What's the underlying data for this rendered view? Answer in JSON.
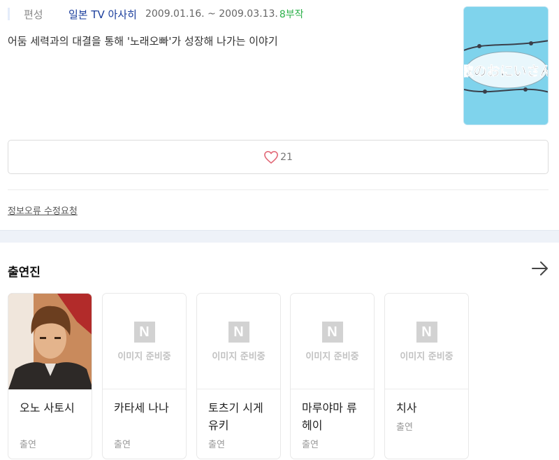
{
  "info": {
    "label": "편성",
    "broadcaster": "일본 TV 아사히",
    "dates": "2009.01.16. ~ 2009.03.13.",
    "episodes": "8부작",
    "synopsis": "어둠 세력과의 대결을 통해 '노래오빠'가 성장해 나가는 이야기",
    "poster_title": "歌のおにいさん"
  },
  "like": {
    "icon": "heart-outline-icon",
    "count": "21"
  },
  "report_link": "정보오류 수정요청",
  "cast": {
    "title": "출연진",
    "more_icon": "arrow-right-icon",
    "placeholder_text": "이미지 준비중",
    "placeholder_logo": "N",
    "members": [
      {
        "name": "오노 사토시",
        "role": "출연",
        "has_photo": true
      },
      {
        "name": "카타세 나나",
        "role": "출연",
        "has_photo": false
      },
      {
        "name": "토츠기 시게유키",
        "role": "출연",
        "has_photo": false
      },
      {
        "name": "마루야마 류헤이",
        "role": "출연",
        "has_photo": false
      },
      {
        "name": "치사",
        "role": "출연",
        "has_photo": false
      }
    ]
  },
  "colors": {
    "broadcaster": "#1a3d9c",
    "episodes": "#2cb04a",
    "heart": "#e26a78",
    "section_gap": "#eef2f8"
  }
}
